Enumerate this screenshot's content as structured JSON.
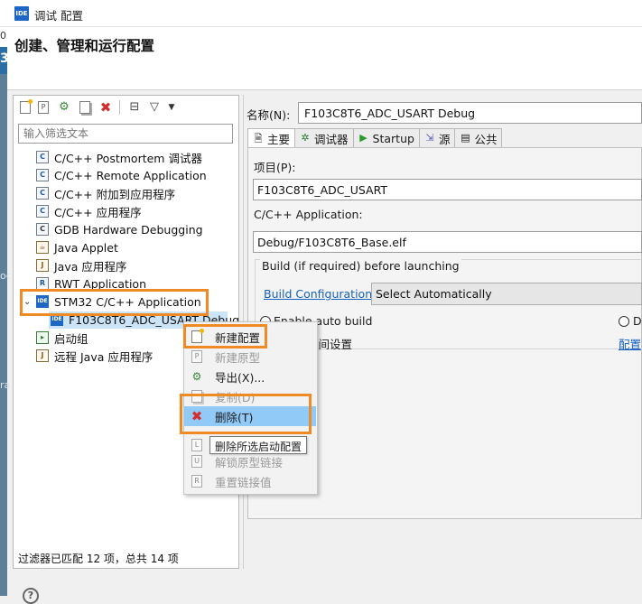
{
  "window": {
    "logo": "IDE",
    "title": "调试 配置"
  },
  "header": {
    "title": "创建、管理和运行配置"
  },
  "edge": {
    "fragment_1": "03",
    "fragment_2": "3",
    "fragment_3": "oc",
    "fragment_4": "ra"
  },
  "toolbar": {
    "icons": [
      "new-launch-config-icon",
      "new-prototype-icon",
      "export-icon",
      "duplicate-icon",
      "delete-icon",
      "collapse-all-icon",
      "filter-icon",
      "view-menu-icon"
    ],
    "delete_color": "#d32f2f"
  },
  "filter": {
    "placeholder": "输入筛选文本",
    "status": "过滤器已匹配 12 项，总共 14 项"
  },
  "tree": {
    "items": [
      {
        "label": "C/C++ Postmortem 调试器",
        "icon": "c"
      },
      {
        "label": "C/C++ Remote Application",
        "icon": "c"
      },
      {
        "label": "C/C++ 附加到应用程序",
        "icon": "c"
      },
      {
        "label": "C/C++ 应用程序",
        "icon": "c"
      },
      {
        "label": "GDB Hardware Debugging",
        "icon": "c"
      },
      {
        "label": "Java Applet",
        "icon": "java-applet"
      },
      {
        "label": "Java 应用程序",
        "icon": "java"
      },
      {
        "label": "RWT Application",
        "icon": "rwt"
      },
      {
        "label": "STM32 C/C++ Application",
        "icon": "ide"
      },
      {
        "label": "F103C8T6_ADC_USART Debug",
        "icon": "ide"
      },
      {
        "label": "启动组",
        "icon": "launch-group"
      },
      {
        "label": "远程 Java 应用程序",
        "icon": "remote-java"
      }
    ]
  },
  "config": {
    "name_label": "名称(N):",
    "name_value": "F103C8T6_ADC_USART Debug",
    "tabs": [
      {
        "label": "主要",
        "icon": "main-tab-icon"
      },
      {
        "label": "调试器",
        "icon": "debugger-tab-icon"
      },
      {
        "label": "Startup",
        "icon": "startup-tab-icon"
      },
      {
        "label": "源",
        "icon": "source-tab-icon"
      },
      {
        "label": "公共",
        "icon": "common-tab-icon"
      }
    ],
    "project_label": "项目(P):",
    "project_value": "F103C8T6_ADC_USART",
    "app_label": "C/C++ Application:",
    "app_value": "Debug/F103C8T6_Base.elf",
    "build_group_label": "Build (if required) before launching",
    "build_config_link": "Build Configuration:",
    "build_config_value": "Select Automatically",
    "enable_auto_build": "Enable auto build",
    "d_fragment": "D",
    "workspace_fragment": "空间设置",
    "config_fragment": "配置"
  },
  "context_menu": {
    "items": [
      {
        "label": "新建配置",
        "enabled": true
      },
      {
        "label": "新建原型",
        "enabled": false
      },
      {
        "label": "导出(X)...",
        "enabled": true
      },
      {
        "label": "复制(D)",
        "enabled": false
      },
      {
        "label": "删除(T)",
        "enabled": true,
        "highlighted": true
      },
      {
        "label": "删除所选启动配置",
        "enabled": true
      },
      {
        "label": "解锁原型链接",
        "enabled": false
      },
      {
        "label": "重置链接值",
        "enabled": false
      }
    ],
    "tooltip": "删除所选启动配置"
  },
  "colors": {
    "accent": "#f08a24",
    "selection": "#cce4f7",
    "menu_highlight": "#91c9f7",
    "link": "#1560c0"
  }
}
